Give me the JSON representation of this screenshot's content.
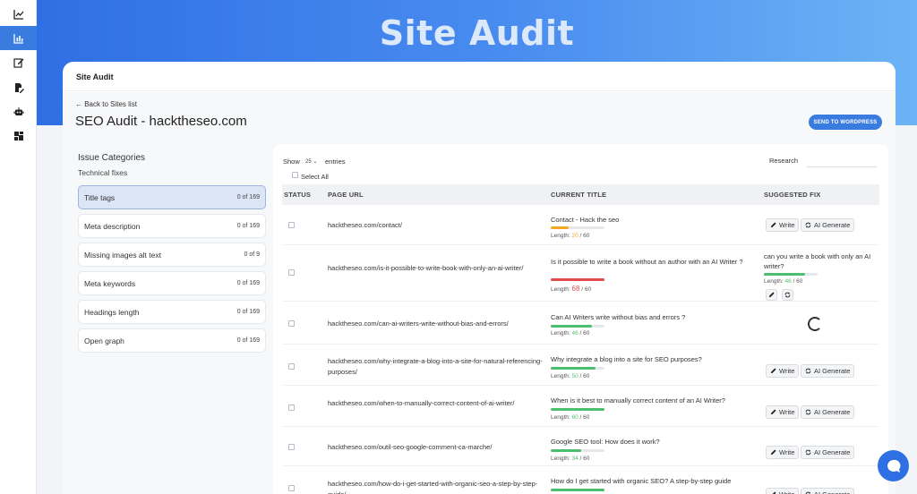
{
  "banner": {
    "title": "Site Audit"
  },
  "card": {
    "header_title": "Site Audit"
  },
  "nav": {
    "back_link": "← Back to Sites list"
  },
  "page": {
    "title": "SEO Audit - hacktheseo.com",
    "send_button": "SEND TO WORDPRESS"
  },
  "sidebar": {
    "items": [
      {
        "icon": "line-chart-icon"
      },
      {
        "icon": "bar-chart-icon",
        "active": true
      },
      {
        "icon": "edit-icon"
      },
      {
        "icon": "document-edit-icon"
      },
      {
        "icon": "robot-icon"
      },
      {
        "icon": "dashboard-icon"
      }
    ]
  },
  "categories": {
    "heading": "Issue Categories",
    "subheading": "Technical fixes",
    "items": [
      {
        "label": "Title tags",
        "count": "0 of 169",
        "active": true
      },
      {
        "label": "Meta description",
        "count": "0 of 169"
      },
      {
        "label": "Missing images alt text",
        "count": "0 of 9"
      },
      {
        "label": "Meta keywords",
        "count": "0 of 169"
      },
      {
        "label": "Headings length",
        "count": "0 of 169"
      },
      {
        "label": "Open graph",
        "count": "0 of 169"
      }
    ]
  },
  "table": {
    "show_label": "Show",
    "show_value": "25",
    "entries_label": "entries",
    "research_label": "Research",
    "select_all_label": "Select All",
    "columns": [
      "STATUS",
      "PAGE URL",
      "CURRENT TITLE",
      "SUGGESTED FIX"
    ],
    "write_label": "Write",
    "ai_generate_label": "AI Generate",
    "length_label": "Length:",
    "rows": [
      {
        "url": "hacktheseo.com/contact/",
        "title": "Contact - Hack the seo",
        "length": "20",
        "max": "/ 60",
        "bar_fraction": 0.33,
        "status": "orange",
        "fix": "buttons"
      },
      {
        "url": "hacktheseo.com/is-it-possible-to-write-book-with-only-an-ai-writer/",
        "title": "Is it possible to write a book without an author with an AI Writer ?",
        "length": "68",
        "max": "/ 60",
        "bar_fraction": 1.0,
        "status": "red",
        "fix": "text",
        "suggestion": "can you write a book with only an AI writer?",
        "suggestion_length": "46",
        "suggestion_max": "/ 60",
        "suggestion_fraction": 0.77
      },
      {
        "url": "hacktheseo.com/can-ai-writers-write-without-bias-and-errors/",
        "title": "Can AI Writers write without bias and errors ?",
        "length": "46",
        "max": "/ 60",
        "bar_fraction": 0.77,
        "status": "green",
        "fix": "loading"
      },
      {
        "url": "hacktheseo.com/why-integrate-a-blog-into-a-site-for-natural-referencing-purposes/",
        "title": "Why integrate a blog into a site for SEO purposes?",
        "length": "50",
        "max": "/ 60",
        "bar_fraction": 0.83,
        "status": "green",
        "fix": "buttons"
      },
      {
        "url": "hacktheseo.com/when-to-manually-correct-content-of-ai-writer/",
        "title": "When is it best to manually correct content of an AI Writer?",
        "length": "60",
        "max": "/ 60",
        "bar_fraction": 1.0,
        "status": "green",
        "fix": "buttons"
      },
      {
        "url": "hacktheseo.com/outil-seo-google-comment-ca-marche/",
        "title": "Google SEO tool: How does it work?",
        "length": "34",
        "max": "/ 60",
        "bar_fraction": 0.57,
        "status": "green",
        "fix": "buttons"
      },
      {
        "url": "hacktheseo.com/how-do-i-get-started-with-organic-seo-a-step-by-step-guide/",
        "title": "How do I get started with organic SEO? A step-by-step guide",
        "length": "",
        "max": "",
        "bar_fraction": 1.0,
        "status": "green",
        "fix": "buttons"
      }
    ]
  },
  "colors": {
    "accent": "#3a7be0",
    "orange": "#f5a623",
    "red": "#e24b4b",
    "green": "#4cbf6e"
  }
}
